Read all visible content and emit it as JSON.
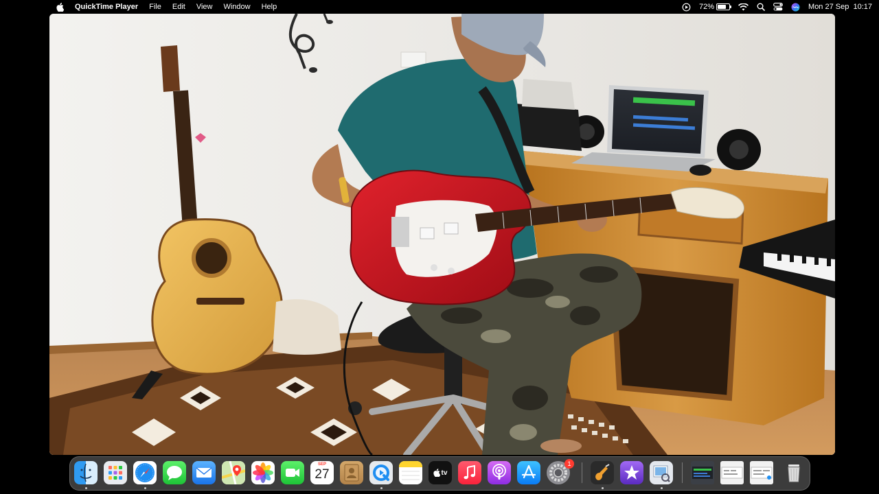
{
  "menubar": {
    "app_name": "QuickTime Player",
    "menus": [
      "File",
      "Edit",
      "View",
      "Window",
      "Help"
    ],
    "battery_percent": "72%",
    "battery_level": 0.72,
    "datetime": "Mon 27 Sep  10:17"
  },
  "dock": {
    "calendar": {
      "month": "SEP",
      "day": "27"
    },
    "tv_label": "tv",
    "system_prefs_badge": "1",
    "apps": [
      {
        "name": "Finder",
        "icon": "finder-icon",
        "running": true
      },
      {
        "name": "Launchpad",
        "icon": "launchpad-icon",
        "running": false
      },
      {
        "name": "Safari",
        "icon": "safari-icon",
        "running": true
      },
      {
        "name": "Messages",
        "icon": "messages-icon",
        "running": false
      },
      {
        "name": "Mail",
        "icon": "mail-icon",
        "running": false
      },
      {
        "name": "Maps",
        "icon": "maps-icon",
        "running": false
      },
      {
        "name": "Photos",
        "icon": "photos-icon",
        "running": false
      },
      {
        "name": "FaceTime",
        "icon": "facetime-icon",
        "running": false
      },
      {
        "name": "Calendar",
        "icon": "calendar-icon",
        "running": false
      },
      {
        "name": "Contacts",
        "icon": "contacts-icon",
        "running": false
      },
      {
        "name": "QuickTime Player",
        "icon": "quicktime-icon",
        "running": true
      },
      {
        "name": "Notes",
        "icon": "notes-icon",
        "running": false
      },
      {
        "name": "TV",
        "icon": "apple-tv-icon",
        "running": false
      },
      {
        "name": "Music",
        "icon": "music-icon",
        "running": false
      },
      {
        "name": "Podcasts",
        "icon": "podcasts-icon",
        "running": false
      },
      {
        "name": "App Store",
        "icon": "app-store-icon",
        "running": false
      },
      {
        "name": "System Preferences",
        "icon": "system-preferences-icon",
        "running": false
      },
      {
        "name": "GarageBand",
        "icon": "garageband-icon",
        "running": true
      },
      {
        "name": "iMovie",
        "icon": "imovie-icon",
        "running": false
      },
      {
        "name": "Preview",
        "icon": "preview-icon",
        "running": true
      }
    ],
    "minimized": [
      "minimized-window-1",
      "minimized-window-2",
      "minimized-window-3"
    ]
  },
  "colors": {
    "wall": "#eceae6",
    "floor": "#c98f52",
    "cabinet": "#c7862f",
    "guitar_red": "#c4121f",
    "shirt": "#1f6b6f"
  }
}
